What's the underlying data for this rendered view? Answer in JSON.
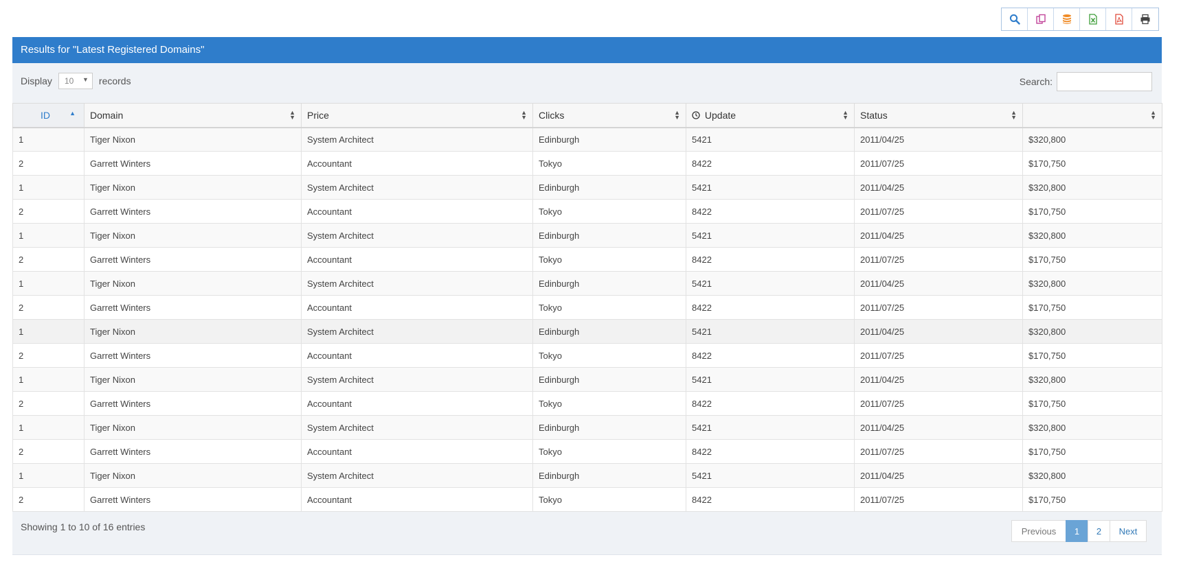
{
  "toolbar": {
    "buttons": [
      {
        "name": "search-icon",
        "color": "#2f7dcb"
      },
      {
        "name": "copy-icon",
        "color": "#c2459a"
      },
      {
        "name": "database-icon",
        "color": "#f08a24"
      },
      {
        "name": "excel-icon",
        "color": "#3f9e3a"
      },
      {
        "name": "pdf-icon",
        "color": "#e04c3c"
      },
      {
        "name": "print-icon",
        "color": "#444444"
      }
    ]
  },
  "panel": {
    "title": "Results for \"Latest Registered Domains\"",
    "accent": "#2f7dcb"
  },
  "controls": {
    "display_label": "Display",
    "display_value": "10",
    "records_label": "records",
    "search_label": "Search:",
    "search_value": ""
  },
  "table": {
    "columns": [
      "ID",
      "Domain",
      "Price",
      "Clicks",
      "Update",
      "Status",
      ""
    ],
    "rows": [
      [
        "1",
        "Tiger Nixon",
        "System Architect",
        "Edinburgh",
        "5421",
        "2011/04/25",
        "$320,800"
      ],
      [
        "2",
        "Garrett Winters",
        "Accountant",
        "Tokyo",
        "8422",
        "2011/07/25",
        "$170,750"
      ],
      [
        "1",
        "Tiger Nixon",
        "System Architect",
        "Edinburgh",
        "5421",
        "2011/04/25",
        "$320,800"
      ],
      [
        "2",
        "Garrett Winters",
        "Accountant",
        "Tokyo",
        "8422",
        "2011/07/25",
        "$170,750"
      ],
      [
        "1",
        "Tiger Nixon",
        "System Architect",
        "Edinburgh",
        "5421",
        "2011/04/25",
        "$320,800"
      ],
      [
        "2",
        "Garrett Winters",
        "Accountant",
        "Tokyo",
        "8422",
        "2011/07/25",
        "$170,750"
      ],
      [
        "1",
        "Tiger Nixon",
        "System Architect",
        "Edinburgh",
        "5421",
        "2011/04/25",
        "$320,800"
      ],
      [
        "2",
        "Garrett Winters",
        "Accountant",
        "Tokyo",
        "8422",
        "2011/07/25",
        "$170,750"
      ],
      [
        "1",
        "Tiger Nixon",
        "System Architect",
        "Edinburgh",
        "5421",
        "2011/04/25",
        "$320,800"
      ],
      [
        "2",
        "Garrett Winters",
        "Accountant",
        "Tokyo",
        "8422",
        "2011/07/25",
        "$170,750"
      ],
      [
        "1",
        "Tiger Nixon",
        "System Architect",
        "Edinburgh",
        "5421",
        "2011/04/25",
        "$320,800"
      ],
      [
        "2",
        "Garrett Winters",
        "Accountant",
        "Tokyo",
        "8422",
        "2011/07/25",
        "$170,750"
      ],
      [
        "1",
        "Tiger Nixon",
        "System Architect",
        "Edinburgh",
        "5421",
        "2011/04/25",
        "$320,800"
      ],
      [
        "2",
        "Garrett Winters",
        "Accountant",
        "Tokyo",
        "8422",
        "2011/07/25",
        "$170,750"
      ],
      [
        "1",
        "Tiger Nixon",
        "System Architect",
        "Edinburgh",
        "5421",
        "2011/04/25",
        "$320,800"
      ],
      [
        "2",
        "Garrett Winters",
        "Accountant",
        "Tokyo",
        "8422",
        "2011/07/25",
        "$170,750"
      ]
    ]
  },
  "footer": {
    "info": "Showing 1 to 10 of 16 entries",
    "previous": "Previous",
    "pages": [
      "1",
      "2"
    ],
    "next": "Next"
  }
}
